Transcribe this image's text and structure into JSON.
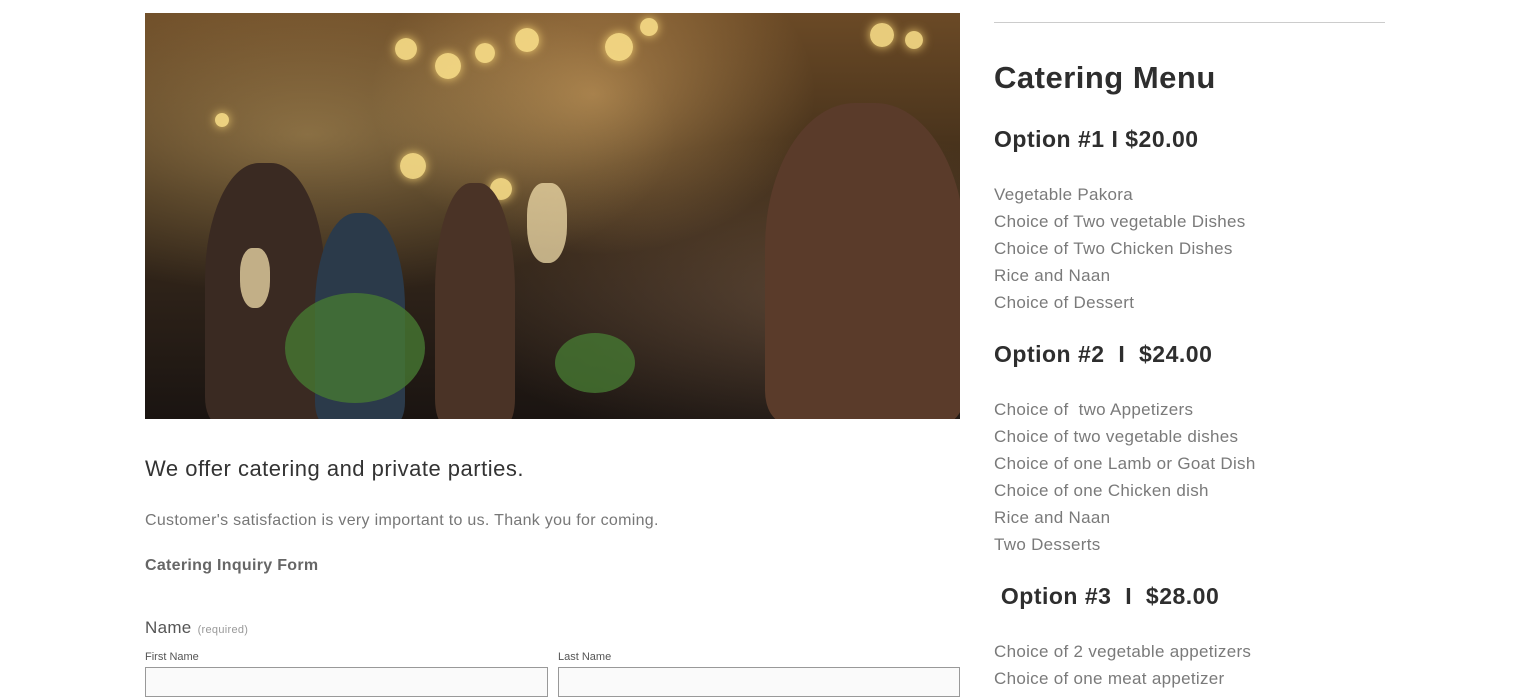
{
  "hero_image": {
    "alt_icon": "party-toast-photo"
  },
  "intro": {
    "heading": "We offer catering and private parties.",
    "text": "Customer's satisfaction is very important to us. Thank you for coming."
  },
  "form": {
    "title": "Catering Inquiry Form",
    "name_label": "Name",
    "required_label": "(required)",
    "first_name_label": "First Name",
    "last_name_label": "Last Name",
    "first_name_value": "",
    "last_name_value": ""
  },
  "menu": {
    "title": "Catering Menu",
    "options": [
      {
        "heading": "Option #1  I $20.00",
        "items": [
          "Vegetable Pakora",
          "Choice of Two vegetable Dishes",
          "Choice of Two Chicken Dishes",
          "Rice and Naan",
          "Choice of Dessert"
        ]
      },
      {
        "heading": "Option #2  I  $24.00",
        "items": [
          "Choice of  two Appetizers",
          "Choice of two vegetable dishes",
          "Choice of one Lamb or Goat Dish",
          "Choice of one Chicken dish",
          "Rice and Naan",
          "Two Desserts"
        ]
      },
      {
        "heading": " Option #3  I  $28.00",
        "items": [
          "Choice of 2 vegetable appetizers",
          "Choice of one meat appetizer"
        ]
      }
    ]
  }
}
